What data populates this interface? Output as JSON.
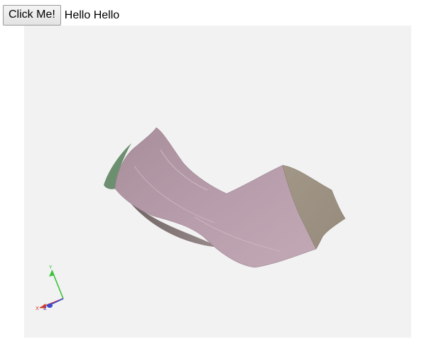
{
  "toolbar": {
    "button_label": "Click Me!",
    "status_text": "Hello Hello"
  },
  "viewer": {
    "background": "#f2f2f2",
    "model": {
      "main_face_color": "#b49aa5",
      "side_face_color": "#a09688",
      "end_face_color": "#6a8c6e",
      "underside_color": "#8a7a7a"
    },
    "axes": {
      "x_label": "X",
      "y_label": "Y",
      "z_label": "Z",
      "x_color": "#d23a2a",
      "y_color": "#3ac23a",
      "z_color": "#3a4ad2"
    }
  }
}
